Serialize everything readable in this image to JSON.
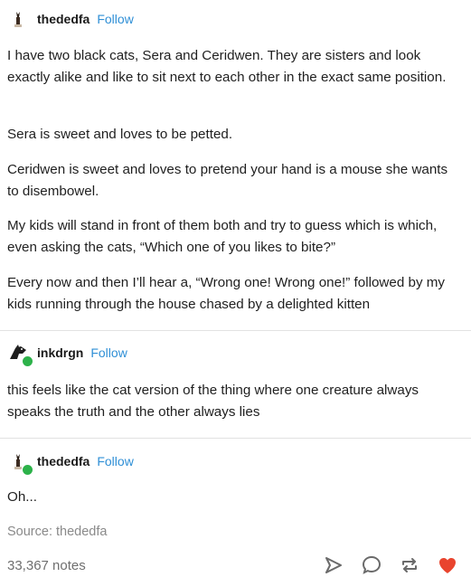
{
  "posts": [
    {
      "username": "thededfa",
      "follow_label": "Follow",
      "paragraphs": [
        "I have two black cats, Sera and Ceridwen. They are sisters and look exactly alike and like to sit next to each other in the exact same position.",
        "Sera is sweet and loves to be petted.",
        "Ceridwen is sweet and loves to pretend your hand is a mouse she wants to disembowel.",
        "My kids will stand in front of them both and try to guess which is which, even asking the cats, “Which one of you likes to bite?”",
        "Every now and then I’ll hear a, “Wrong one! Wrong one!” followed by my kids running through the house chased by a delighted kitten"
      ]
    },
    {
      "username": "inkdrgn",
      "follow_label": "Follow",
      "paragraphs": [
        "this feels like the cat version of the thing where one creature always speaks the truth and the other always lies"
      ]
    },
    {
      "username": "thededfa",
      "follow_label": "Follow",
      "paragraphs": [
        "Oh..."
      ]
    }
  ],
  "source": "Source: thededfa",
  "notes": "33,367 notes",
  "colors": {
    "link": "#2f8fd6",
    "heart": "#e9442e",
    "badge": "#2db24a"
  },
  "icons": [
    "share-icon",
    "reply-icon",
    "reblog-icon",
    "heart-icon"
  ]
}
